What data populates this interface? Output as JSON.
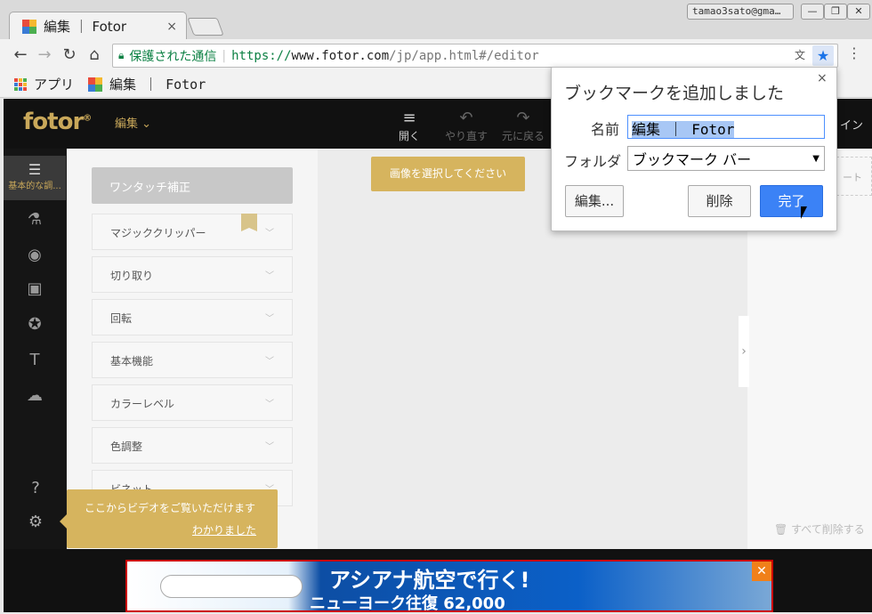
{
  "browser": {
    "tab_title": "編集 ｜ Fotor",
    "tab_close": "×",
    "profile": "tamao3sato@gma…",
    "window_min": "—",
    "window_restore": "❐",
    "window_close": "✕",
    "security_label": "保護された通信",
    "url_scheme": "https://",
    "url_host": "www.fotor.com",
    "url_path": "/jp/app.html#/editor",
    "back": "←",
    "forward": "→",
    "reload": "↻",
    "home": "⌂",
    "star": "★",
    "menu": "⋮"
  },
  "bookmarks_bar": {
    "apps_label": "アプリ",
    "item_label": "編集 ｜ Fotor"
  },
  "fotor": {
    "logo": "fotor",
    "logo_mark": "®",
    "edit_menu": "編集",
    "tools": [
      {
        "label": "開く",
        "icon": "≡"
      },
      {
        "label": "やり直す",
        "icon": "↶"
      },
      {
        "label": "元に戻る",
        "icon": "↷"
      }
    ],
    "right_header_fragment": "イン",
    "sidebar_active_label": "基本的な調...",
    "panel": {
      "header": "ワンタッチ補正",
      "items": [
        "マジッククリッパー",
        "切り取り",
        "回転",
        "基本機能",
        "カラーレベル",
        "色調整",
        "ビネット"
      ]
    },
    "select_image_tip": "画像を選択してください",
    "right_fragment": "ート",
    "delete_all": "すべて削除する",
    "video_tip": {
      "text": "ここからビデオをご覧いただけます",
      "ok": "わかりました"
    }
  },
  "ad": {
    "line1": "アシアナ航空で行く!",
    "line2": "ニューヨーク往復 62,000",
    "close": "✕"
  },
  "bookmark_bubble": {
    "title": "ブックマークを追加しました",
    "close": "×",
    "name_label": "名前",
    "name_value": "編集 ｜ Fotor",
    "folder_label": "フォルダ",
    "folder_value": "ブックマーク バー",
    "edit_button": "編集...",
    "delete_button": "削除",
    "done_button": "完了"
  },
  "colors": {
    "accent_gold": "#d6b45e",
    "chrome_blue": "#3b82f6"
  }
}
